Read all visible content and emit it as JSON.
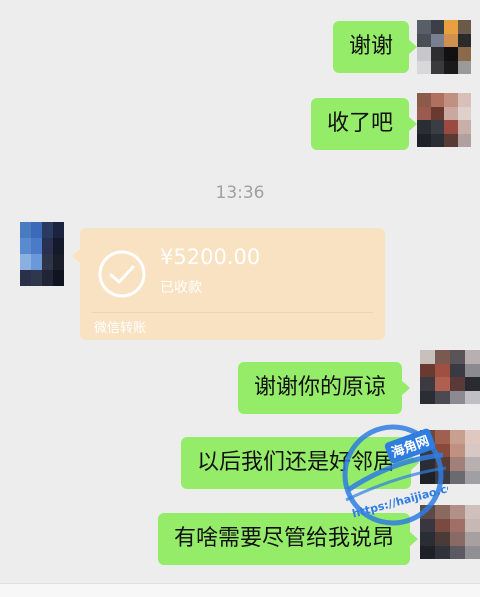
{
  "messages": [
    {
      "text": "谢谢"
    },
    {
      "text": "收了吧"
    },
    {
      "text": "谢谢你的原谅"
    },
    {
      "text": "以后我们还是好邻居"
    },
    {
      "text": "有啥需要尽管给我说昂"
    }
  ],
  "timestamp": "13:36",
  "transfer": {
    "amount": "¥5200.00",
    "status": "已收款",
    "footer": "微信转账",
    "icon": "check-circle-icon"
  },
  "watermark": {
    "name": "海角网",
    "url": "https://haijiao.com"
  },
  "colors": {
    "background": "#EDEDED",
    "sent_bubble": "#95EC69",
    "transfer_card": "#F9E2C2",
    "timestamp_text": "#A0A0A0",
    "watermark": "#2F7DE0"
  }
}
